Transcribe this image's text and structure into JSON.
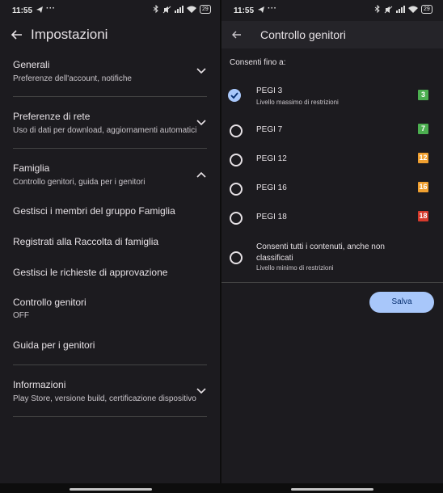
{
  "status_bar": {
    "time": "11:55",
    "telegram_icon": "send-icon",
    "more": "···",
    "battery": "29"
  },
  "left": {
    "title": "Impostazioni",
    "sections": [
      {
        "title": "Generali",
        "subtitle": "Preferenze dell'account, notifiche",
        "expanded": false
      },
      {
        "title": "Preferenze di rete",
        "subtitle": "Uso di dati per download, aggiornamenti automatici",
        "expanded": false
      },
      {
        "title": "Famiglia",
        "subtitle": "Controllo genitori, guida per i genitori",
        "expanded": true
      },
      {
        "title": "Informazioni",
        "subtitle": "Play Store, versione build, certificazione dispositivo",
        "expanded": false
      }
    ],
    "family_items": [
      {
        "label": "Gestisci i membri del gruppo Famiglia"
      },
      {
        "label": "Registrati alla Raccolta di famiglia"
      },
      {
        "label": "Gestisci le richieste di approvazione"
      },
      {
        "label": "Controllo genitori",
        "value": "OFF"
      },
      {
        "label": "Guida per i genitori"
      }
    ]
  },
  "right": {
    "title": "Controllo genitori",
    "allow_label": "Consenti fino a:",
    "options": [
      {
        "label": "PEGI 3",
        "sublabel": "Livello massimo di restrizioni",
        "badge": "3",
        "badge_color": "#4caf50",
        "selected": true
      },
      {
        "label": "PEGI 7",
        "badge": "7",
        "badge_color": "#4caf50",
        "selected": false
      },
      {
        "label": "PEGI 12",
        "badge": "12",
        "badge_color": "#f0a030",
        "selected": false
      },
      {
        "label": "PEGI 16",
        "badge": "16",
        "badge_color": "#f0a030",
        "selected": false
      },
      {
        "label": "PEGI 18",
        "badge": "18",
        "badge_color": "#d63a2c",
        "selected": false
      },
      {
        "label": "Consenti tutti i contenuti, anche non classificati",
        "sublabel": "Livello minimo di restrizioni",
        "selected": false
      }
    ],
    "save_label": "Salva"
  },
  "colors": {
    "background": "#1c1b1f",
    "accent": "#a8c7fa",
    "text": "#e6e1e5"
  }
}
